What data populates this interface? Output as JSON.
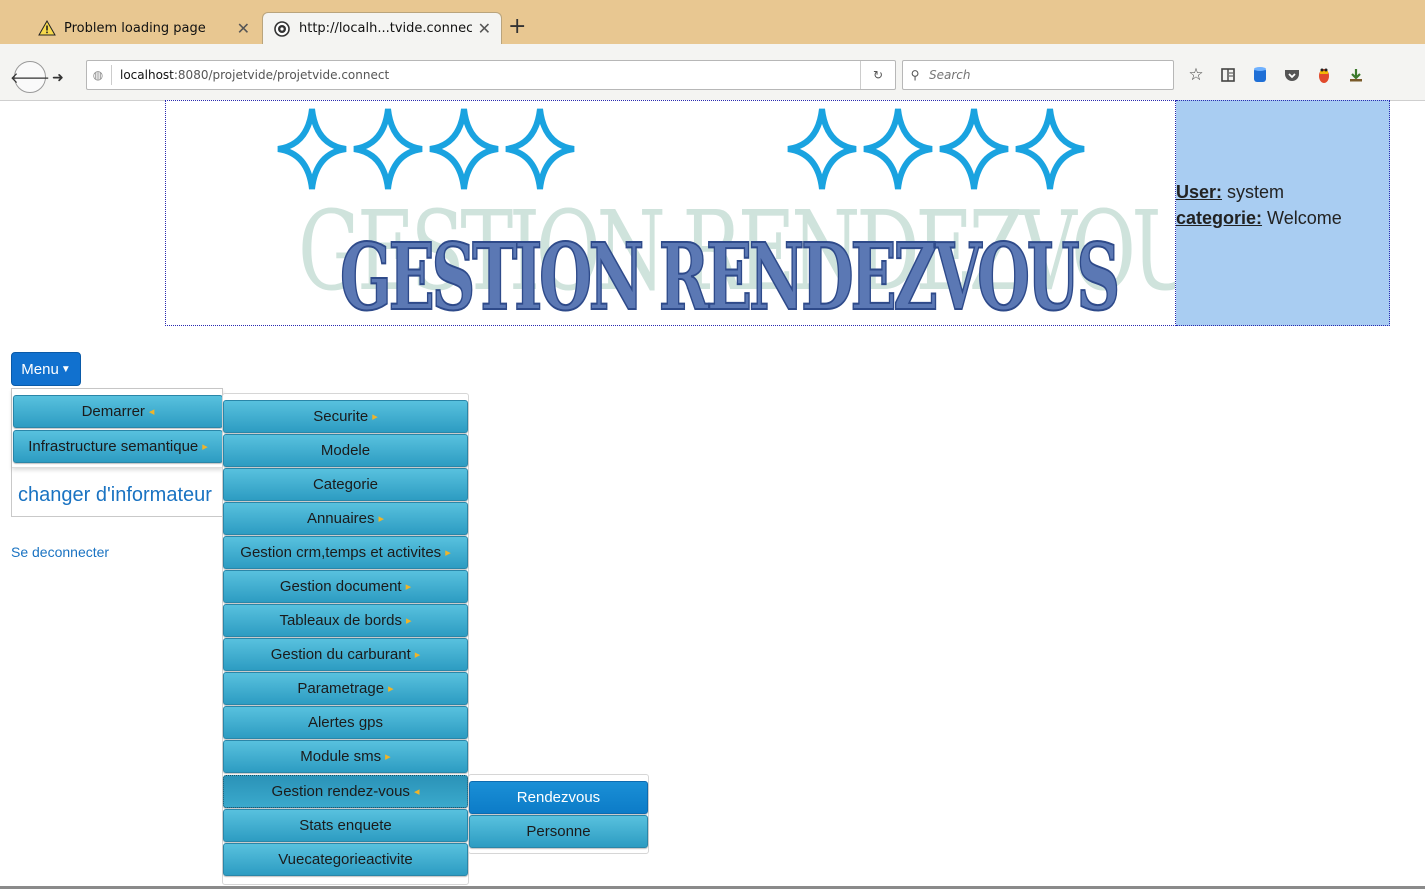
{
  "browser": {
    "tabs": [
      {
        "title": "Problem loading page",
        "icon": "warning-icon",
        "active": false
      },
      {
        "title": "http://localh...tvide.connect",
        "icon": "tor-onion-icon",
        "active": true
      }
    ],
    "new_tab": "+",
    "url_host": "localhost",
    "url_rest": ":8080/projetvide/projetvide.connect",
    "search_placeholder": "Search",
    "toolbar_icons": [
      "bookmark-star-icon",
      "reading-list-icon",
      "database-icon",
      "pocket-icon",
      "firebug-icon",
      "download-icon"
    ]
  },
  "banner": {
    "ghost_title": "GESTION RENDEZVOUS",
    "title": "GESTION RENDEZVOUS",
    "star_color": "#1aa3e0"
  },
  "user_panel": {
    "user_label": "User:",
    "user_value": "system",
    "category_label": "categorie:",
    "category_value": "Welcome"
  },
  "menu": {
    "button_label": "Menu",
    "items": [
      {
        "label": "Demarrer",
        "arrow": "◂"
      },
      {
        "label": "Infrastructure semantique",
        "arrow": "▸"
      }
    ],
    "change_link": "changer d'informateur",
    "logout_link": "Se deconnecter",
    "submenu": [
      {
        "label": "Securite",
        "arrow": "▸"
      },
      {
        "label": "Modele",
        "arrow": ""
      },
      {
        "label": "Categorie",
        "arrow": ""
      },
      {
        "label": "Annuaires",
        "arrow": "▸"
      },
      {
        "label": "Gestion crm,temps et activites",
        "arrow": "▸"
      },
      {
        "label": "Gestion document",
        "arrow": "▸"
      },
      {
        "label": "Tableaux de bords",
        "arrow": "▸"
      },
      {
        "label": "Gestion du carburant",
        "arrow": "▸"
      },
      {
        "label": "Parametrage",
        "arrow": "▸"
      },
      {
        "label": "Alertes gps",
        "arrow": ""
      },
      {
        "label": "Module sms",
        "arrow": "▸"
      },
      {
        "label": "Gestion rendez-vous",
        "arrow": "◂"
      },
      {
        "label": "Stats enquete",
        "arrow": ""
      },
      {
        "label": "Vuecategorieactivite",
        "arrow": ""
      }
    ],
    "submenu2": [
      {
        "label": "Rendezvous"
      },
      {
        "label": "Personne"
      }
    ]
  }
}
